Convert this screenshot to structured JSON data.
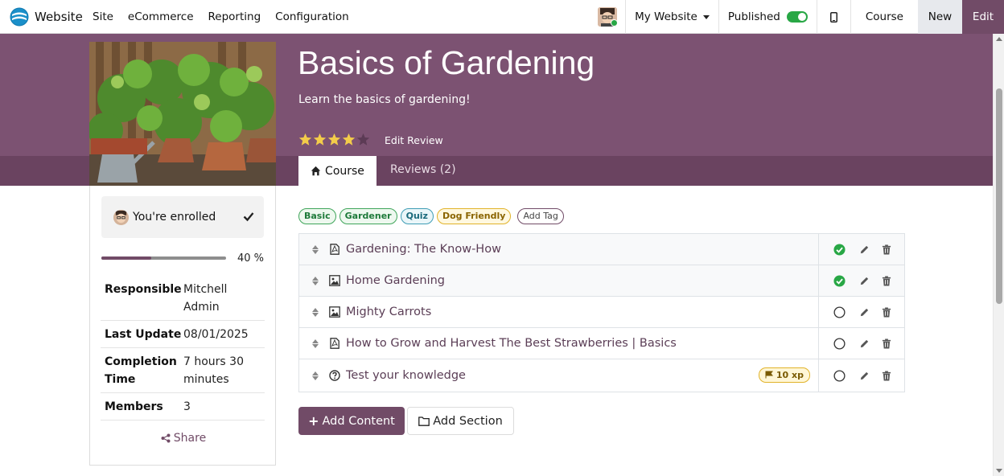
{
  "topbar": {
    "app_name": "Website",
    "menu": [
      "Site",
      "eCommerce",
      "Reporting",
      "Configuration"
    ],
    "website_selector": "My Website",
    "published_label": "Published",
    "published": true,
    "course_label": "Course",
    "new_label": "New",
    "edit_label": "Edit"
  },
  "hero": {
    "title": "Basics of Gardening",
    "subtitle": "Learn the basics of gardening!",
    "rating": 4,
    "rating_max": 5,
    "edit_review_label": "Edit Review",
    "tabs": [
      {
        "label": "Course",
        "icon": "home-icon",
        "active": true
      },
      {
        "label": "Reviews (2)",
        "active": false
      }
    ]
  },
  "sidebar": {
    "enrolled_label": "You're enrolled",
    "progress_value": 0.4,
    "progress_label": "40 %",
    "info": [
      {
        "key": "Responsible",
        "value": "Mitchell Admin"
      },
      {
        "key": "Last Update",
        "value": "08/01/2025"
      },
      {
        "key": "Completion Time",
        "value": "7 hours 30 minutes"
      },
      {
        "key": "Members",
        "value": "3"
      }
    ],
    "share_label": "Share"
  },
  "tags": [
    {
      "label": "Basic",
      "color": "green"
    },
    {
      "label": "Gardener",
      "color": "green"
    },
    {
      "label": "Quiz",
      "color": "teal"
    },
    {
      "label": "Dog Friendly",
      "color": "yellow"
    }
  ],
  "add_tag_label": "Add Tag",
  "contents": [
    {
      "title": "Gardening: The Know-How",
      "type_icon": "pdf-file-icon",
      "done": true
    },
    {
      "title": "Home Gardening",
      "type_icon": "image-file-icon",
      "done": true
    },
    {
      "title": "Mighty Carrots",
      "type_icon": "image-file-icon",
      "done": false
    },
    {
      "title": "How to Grow and Harvest The Best Strawberries | Basics",
      "type_icon": "pdf-file-icon",
      "done": false
    },
    {
      "title": "Test your knowledge",
      "type_icon": "question-circle-icon",
      "done": false,
      "xp": "10 xp"
    }
  ],
  "buttons": {
    "add_content": "Add Content",
    "add_section": "Add Section"
  },
  "colors": {
    "brand": "#714b67",
    "hero": "#7c5272",
    "success": "#28a745"
  }
}
